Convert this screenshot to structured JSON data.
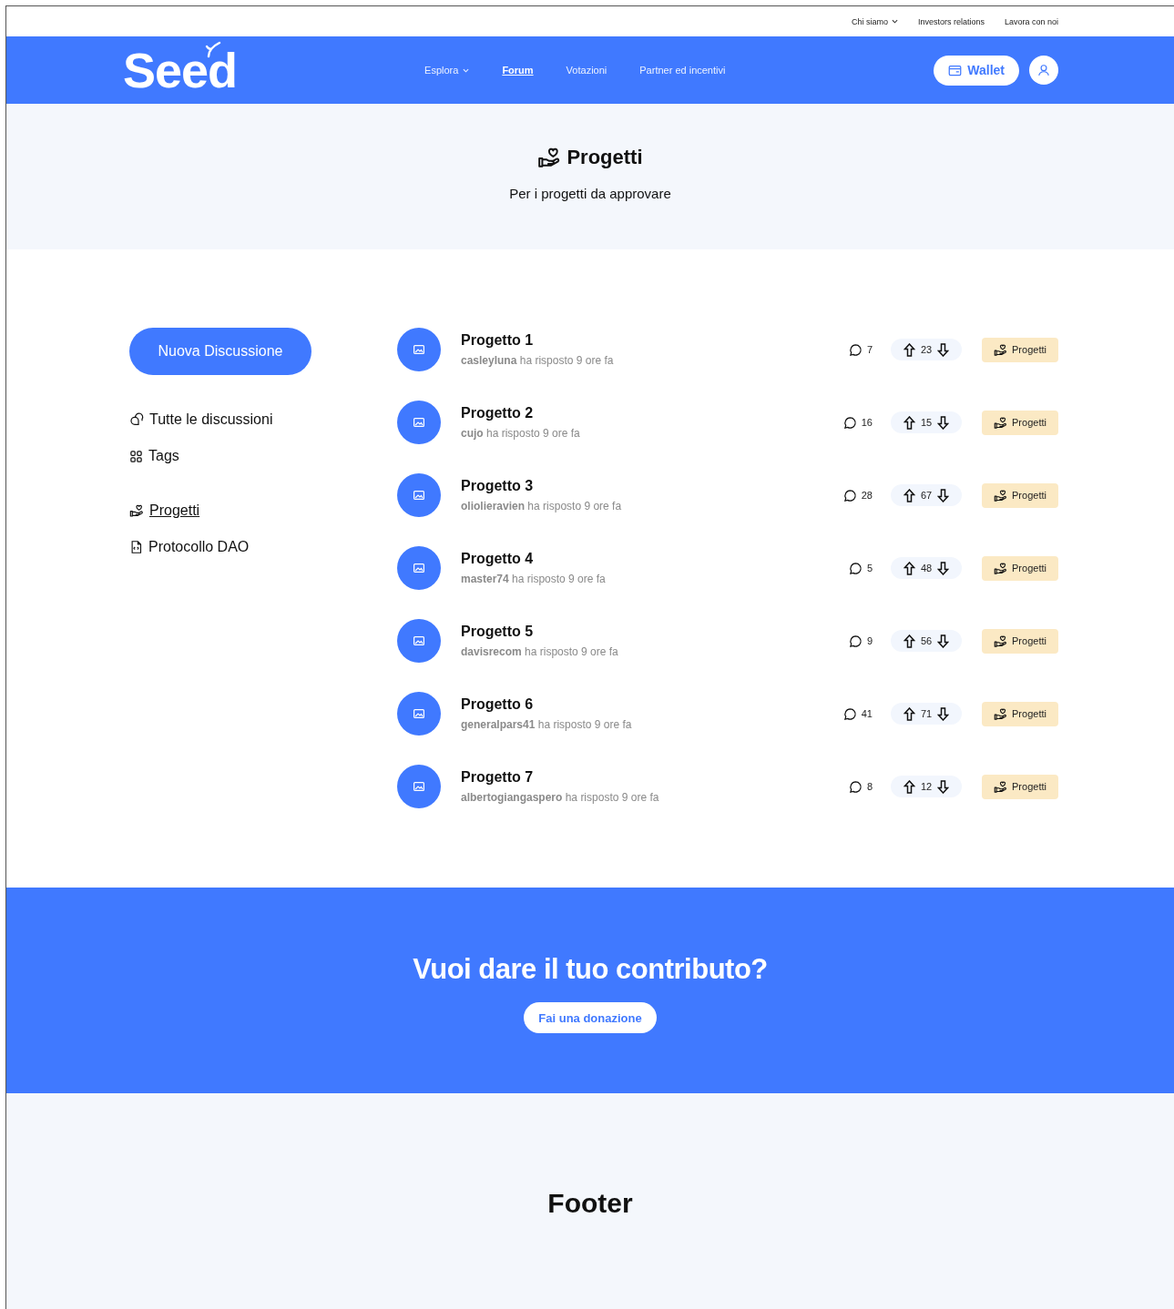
{
  "top_links": [
    {
      "label": "Chi siamo",
      "dropdown": true
    },
    {
      "label": "Investors relations",
      "dropdown": false
    },
    {
      "label": "Lavora con noi",
      "dropdown": false
    }
  ],
  "header": {
    "logo": "Seed",
    "nav": [
      {
        "label": "Esplora",
        "dropdown": true,
        "selected": false
      },
      {
        "label": "Forum",
        "dropdown": false,
        "selected": true
      },
      {
        "label": "Votazioni",
        "dropdown": false,
        "selected": false
      },
      {
        "label": "Partner ed incentivi",
        "dropdown": false,
        "selected": false
      }
    ],
    "wallet_button": "Wallet"
  },
  "hero": {
    "title": "Progetti",
    "subtitle": "Per i progetti da approvare"
  },
  "sidebar": {
    "new_button": "Nuova Discussione",
    "items": [
      {
        "kind": "discussions",
        "label": "Tutte le discussioni",
        "selected": false
      },
      {
        "kind": "tags",
        "label": "Tags",
        "selected": false
      },
      {
        "kind": "projects",
        "label": "Progetti",
        "selected": true
      },
      {
        "kind": "document",
        "label": "Protocollo DAO",
        "selected": false
      }
    ]
  },
  "threads": [
    {
      "title": "Progetto 1",
      "meta": "**casleyluna** ha risposto 9 ore fa",
      "comments": "7",
      "votes": "23",
      "tag": "Progetti"
    },
    {
      "title": "Progetto 2",
      "meta": "**cujo** ha risposto 9 ore fa",
      "comments": "16",
      "votes": "15",
      "tag": "Progetti"
    },
    {
      "title": "Progetto 3",
      "meta": "**oliolieravien** ha risposto 9 ore fa",
      "comments": "28",
      "votes": "67",
      "tag": "Progetti"
    },
    {
      "title": "Progetto 4",
      "meta": "**master74** ha risposto 9 ore fa",
      "comments": "5",
      "votes": "48",
      "tag": "Progetti"
    },
    {
      "title": "Progetto 5",
      "meta": "**davisrecom** ha risposto 9 ore fa",
      "comments": "9",
      "votes": "56",
      "tag": "Progetti"
    },
    {
      "title": "Progetto 6",
      "meta": "**generalpars41** ha risposto 9 ore fa",
      "comments": "41",
      "votes": "71",
      "tag": "Progetti"
    },
    {
      "title": "Progetto 7",
      "meta": "**albertogiangaspero** ha risposto 9 ore fa",
      "comments": "8",
      "votes": "12",
      "tag": "Progetti"
    }
  ],
  "cta": {
    "title": "Vuoi dare il tuo contributo?",
    "button": "Fai una donazione"
  },
  "footer": {
    "title": "Footer"
  }
}
